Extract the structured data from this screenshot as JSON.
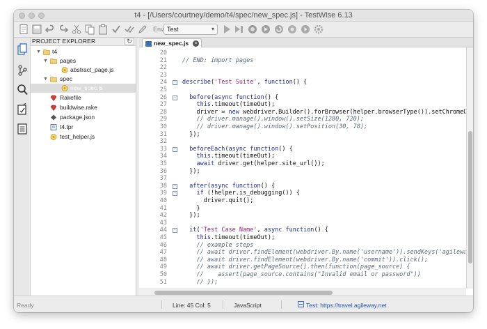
{
  "window": {
    "title": "t4 - [/Users/courtney/demo/t4/spec/new_spec.js] - TestWise 6.13"
  },
  "toolbar": {
    "env_label": "Env:",
    "env_value": "Test"
  },
  "explorer": {
    "title": "PROJECT EXPLORER",
    "refresh_icon": "refresh-icon",
    "items": [
      {
        "label": "t4",
        "icon": "folder-icon"
      },
      {
        "label": "pages",
        "icon": "folder-icon"
      },
      {
        "label": "abstract_page.js",
        "icon": "js-file-icon"
      },
      {
        "label": "spec",
        "icon": "folder-icon"
      },
      {
        "label": "new_spec.js",
        "icon": "js-file-icon"
      },
      {
        "label": "Rakefile",
        "icon": "ruby-file-icon"
      },
      {
        "label": "buildwise.rake",
        "icon": "ruby-file-icon"
      },
      {
        "label": "package.json",
        "icon": "json-file-icon"
      },
      {
        "label": "t4.tpr",
        "icon": "project-file-icon"
      },
      {
        "label": "test_helper.js",
        "icon": "js-file-icon"
      }
    ]
  },
  "editor": {
    "tab_label": "new_spec.js",
    "lines": [
      {
        "n": "20",
        "text": ""
      },
      {
        "n": "21",
        "text": "// END: import pages"
      },
      {
        "n": "22",
        "text": ""
      },
      {
        "n": "23",
        "text": ""
      },
      {
        "n": "24",
        "text": "describe('Test Suite', function() {"
      },
      {
        "n": "25",
        "text": ""
      },
      {
        "n": "26",
        "text": "  before(async function() {"
      },
      {
        "n": "27",
        "text": "    this.timeout(timeOut);"
      },
      {
        "n": "28",
        "text": "    driver = new webdriver.Builder().forBrowser(helper.browserType()).setChromeOptions(helper.chromeOptions())"
      },
      {
        "n": "29",
        "text": "    // driver.manage().window().setSize(1280, 720);"
      },
      {
        "n": "30",
        "text": "    // driver.manage().window().setPosition(30, 78);"
      },
      {
        "n": "31",
        "text": "  });"
      },
      {
        "n": "32",
        "text": ""
      },
      {
        "n": "33",
        "text": "  beforeEach(async function() {"
      },
      {
        "n": "34",
        "text": "    this.timeout(timeOut);"
      },
      {
        "n": "35",
        "text": "    await driver.get(helper.site_url());"
      },
      {
        "n": "36",
        "text": "  });"
      },
      {
        "n": "37",
        "text": ""
      },
      {
        "n": "38",
        "text": "  after(async function() {"
      },
      {
        "n": "39",
        "text": "    if (!helper.is_debugging()) {"
      },
      {
        "n": "40",
        "text": "      driver.quit();"
      },
      {
        "n": "41",
        "text": "    }"
      },
      {
        "n": "42",
        "text": "  });"
      },
      {
        "n": "43",
        "text": ""
      },
      {
        "n": "44",
        "text": "  it('Test Case Name', async function() {"
      },
      {
        "n": "45",
        "text": "    this.timeout(timeOut);"
      },
      {
        "n": "46",
        "text": "    // example steps"
      },
      {
        "n": "47",
        "text": "    // await driver.findElement(webdriver.By.name('username')).sendKeys('agileway');"
      },
      {
        "n": "48",
        "text": "    // await driver.findElement(webdriver.By.name('commit')).click();"
      },
      {
        "n": "49",
        "text": "    // await driver.getPageSource().then(function(page_source) {"
      },
      {
        "n": "50",
        "text": "    //    assert(page_source.contains(\"Invalid email or password\"))"
      },
      {
        "n": "51",
        "text": "    // });"
      }
    ]
  },
  "status": {
    "ready": "Ready",
    "position": "Line: 45  Col: 5",
    "language": "JavaScript",
    "test_url": "Test: https://travel.agileway.net"
  },
  "colors": {
    "keyword": "#1c2a9e",
    "string": "#9b1d7a",
    "comment": "#5b6a7a",
    "link": "#1f4fa8"
  }
}
